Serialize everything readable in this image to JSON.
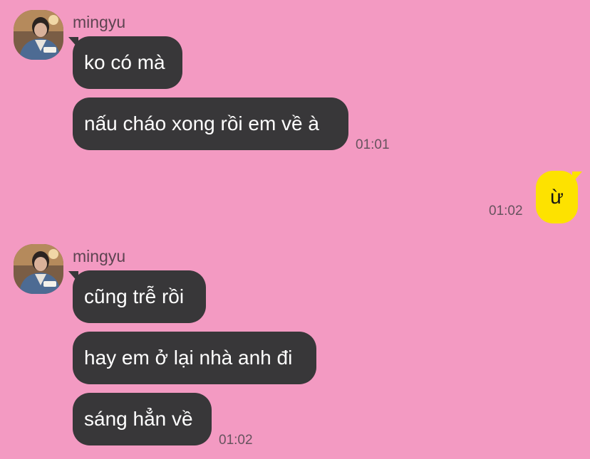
{
  "chat": {
    "colors": {
      "background": "#f39ac2",
      "incoming_bubble": "#383739",
      "outgoing_bubble": "#fde200"
    },
    "groups": [
      {
        "sender": "mingyu",
        "messages": [
          "ko có mà",
          "nấu cháo xong rồi em về à"
        ],
        "time": "01:01"
      },
      {
        "outgoing": true,
        "messages": [
          "ừ"
        ],
        "time": "01:02"
      },
      {
        "sender": "mingyu",
        "messages": [
          "cũng trễ rồi",
          "hay em ở lại nhà anh đi",
          "sáng hẳn về"
        ],
        "time": "01:02"
      }
    ]
  }
}
